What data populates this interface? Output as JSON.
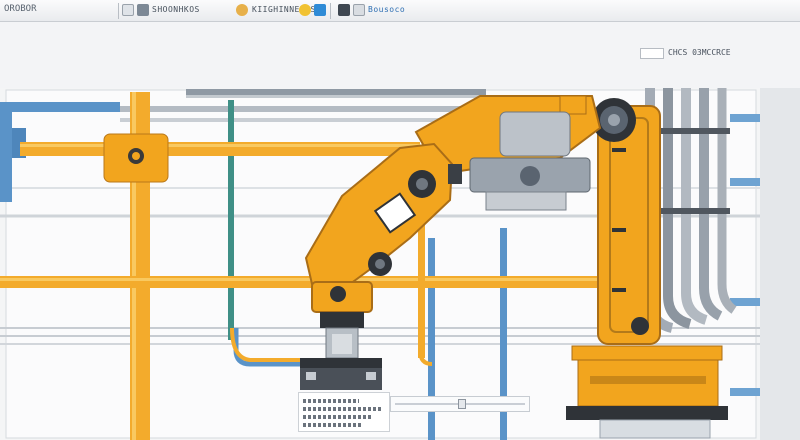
{
  "toolbar": {
    "title": "OROBOR",
    "group_a": "SHOONHKOS",
    "group_b": "KIIGHINNENES",
    "group_c": "Bousoco"
  },
  "properties": {
    "button_label": "",
    "label": "CHCS 03MCCRCE"
  },
  "tabs": [
    "",
    "",
    ""
  ],
  "colors": {
    "arm_yellow": "#f2a51e",
    "pipe_orange": "#f3ab2c",
    "pipe_blue": "#5a93c8",
    "pipe_teal": "#3f8f86",
    "steel": "#9aa3ad",
    "dark": "#2f3338"
  },
  "icons": [
    "new-icon",
    "open-icon",
    "save-icon",
    "undo-icon",
    "redo-icon",
    "help-icon",
    "grid-icon"
  ],
  "timeline": {
    "position_fraction": 0.52
  }
}
